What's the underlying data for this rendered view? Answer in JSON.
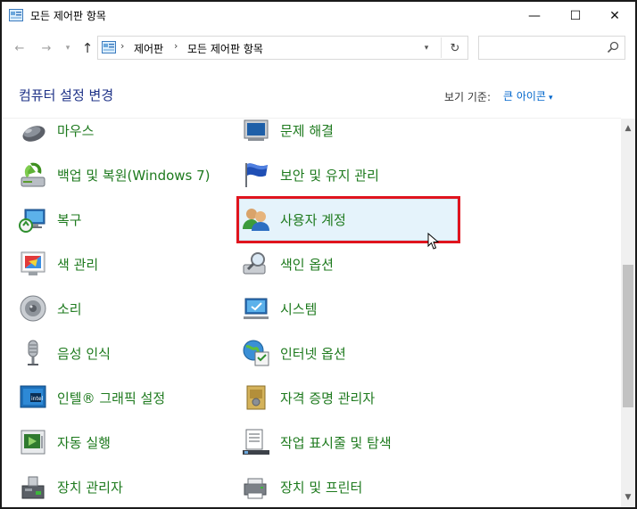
{
  "window": {
    "title": "모든 제어판 항목",
    "min_glyph": "—",
    "max_glyph": "☐",
    "close_glyph": "✕"
  },
  "nav": {
    "back_glyph": "←",
    "forward_glyph": "→",
    "recent_glyph": "▾",
    "up_glyph": "↑",
    "breadcrumbs": [
      "제어판",
      "모든 제어판 항목"
    ],
    "separator": "›",
    "dropdown_glyph": "▾",
    "refresh_glyph": "↻"
  },
  "search": {
    "value": "",
    "placeholder": ""
  },
  "header": {
    "title": "컴퓨터 설정 변경",
    "view_by_label": "보기 기준:",
    "view_by_value": "큰 아이콘",
    "view_by_caret": "▾"
  },
  "items": [
    {
      "label": "마우스",
      "icon": "mouse-icon"
    },
    {
      "label": "문제 해결",
      "icon": "troubleshooting-icon"
    },
    {
      "label": "백업 및 복원(Windows 7)",
      "icon": "backup-restore-icon"
    },
    {
      "label": "보안 및 유지 관리",
      "icon": "security-maintenance-flag-icon"
    },
    {
      "label": "복구",
      "icon": "recovery-icon"
    },
    {
      "label": "사용자 계정",
      "icon": "user-accounts-icon"
    },
    {
      "label": "색 관리",
      "icon": "color-management-icon"
    },
    {
      "label": "색인 옵션",
      "icon": "indexing-options-icon"
    },
    {
      "label": "소리",
      "icon": "sound-speaker-icon"
    },
    {
      "label": "시스템",
      "icon": "system-monitor-icon"
    },
    {
      "label": "음성 인식",
      "icon": "microphone-icon"
    },
    {
      "label": "인터넷 옵션",
      "icon": "internet-options-icon"
    },
    {
      "label": "인텔® 그래픽 설정",
      "icon": "intel-graphics-icon"
    },
    {
      "label": "자격 증명 관리자",
      "icon": "credential-manager-icon"
    },
    {
      "label": "자동 실행",
      "icon": "autoplay-icon"
    },
    {
      "label": "작업 표시줄 및 탐색",
      "icon": "taskbar-navigation-icon"
    },
    {
      "label": "장치 관리자",
      "icon": "device-manager-icon"
    },
    {
      "label": "장치 및 프린터",
      "icon": "devices-printers-icon"
    }
  ],
  "scrollbar": {
    "up_glyph": "▲",
    "down_glyph": "▼"
  },
  "colors": {
    "item_text": "#1e7a1e",
    "header_title": "#1e3287",
    "link": "#0066cc",
    "selection_border": "#e0141e",
    "selection_fill": "#e5f3fb"
  }
}
